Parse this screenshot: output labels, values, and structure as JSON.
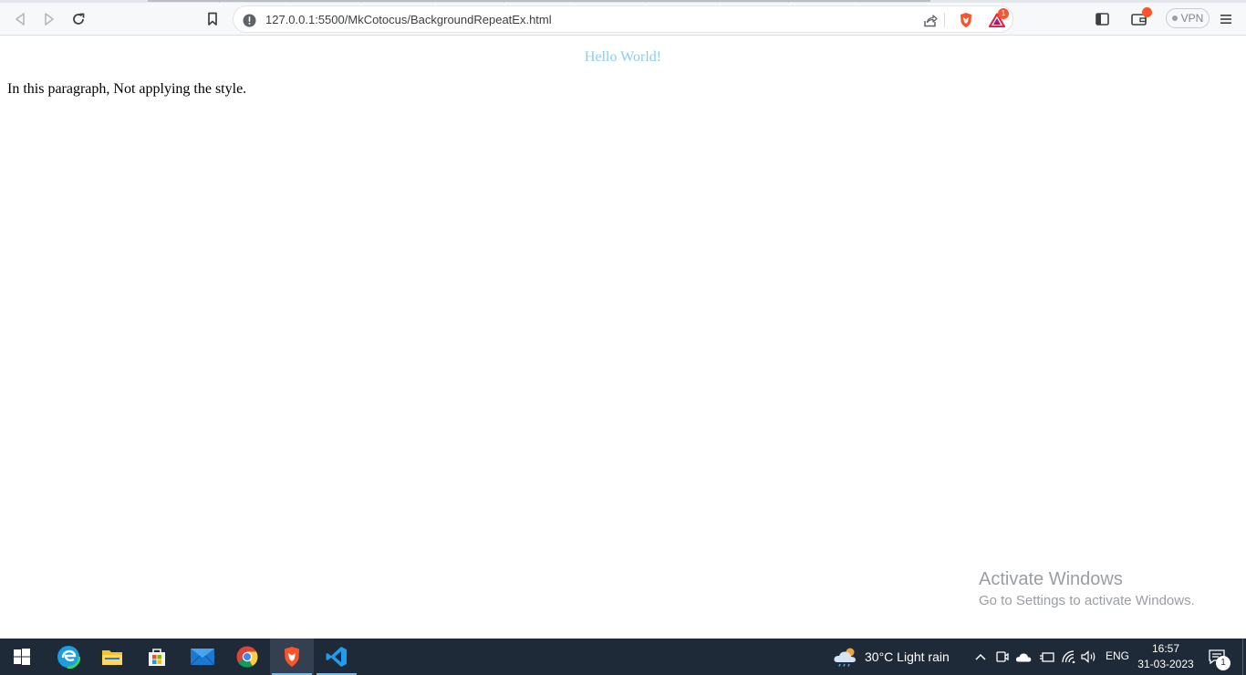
{
  "browser": {
    "url": "127.0.0.1:5500/MkCotocus/BackgroundRepeatEx.html",
    "notification_count": "1",
    "vpn_label": "VPN",
    "icons": [
      "back-icon",
      "forward-icon",
      "reload-icon",
      "bookmark-icon",
      "site-info-icon",
      "share-icon",
      "brave-shields-icon",
      "brave-rewards-icon",
      "sidebar-icon",
      "wallet-icon",
      "menu-icon"
    ]
  },
  "page": {
    "heading": "Hello World!",
    "heading_color": "#87ceeb",
    "paragraph": "In this paragraph, Not applying the style."
  },
  "watermark": {
    "title": "Activate Windows",
    "subtitle": "Go to Settings to activate Windows."
  },
  "taskbar": {
    "apps": [
      "start-icon",
      "edge-icon",
      "file-explorer-icon",
      "store-icon",
      "mail-icon",
      "chrome-icon",
      "brave-icon",
      "vscode-icon"
    ],
    "weather": "30°C  Light rain",
    "language": "ENG",
    "time": "16:57",
    "date": "31-03-2023",
    "notification_count": "1"
  }
}
